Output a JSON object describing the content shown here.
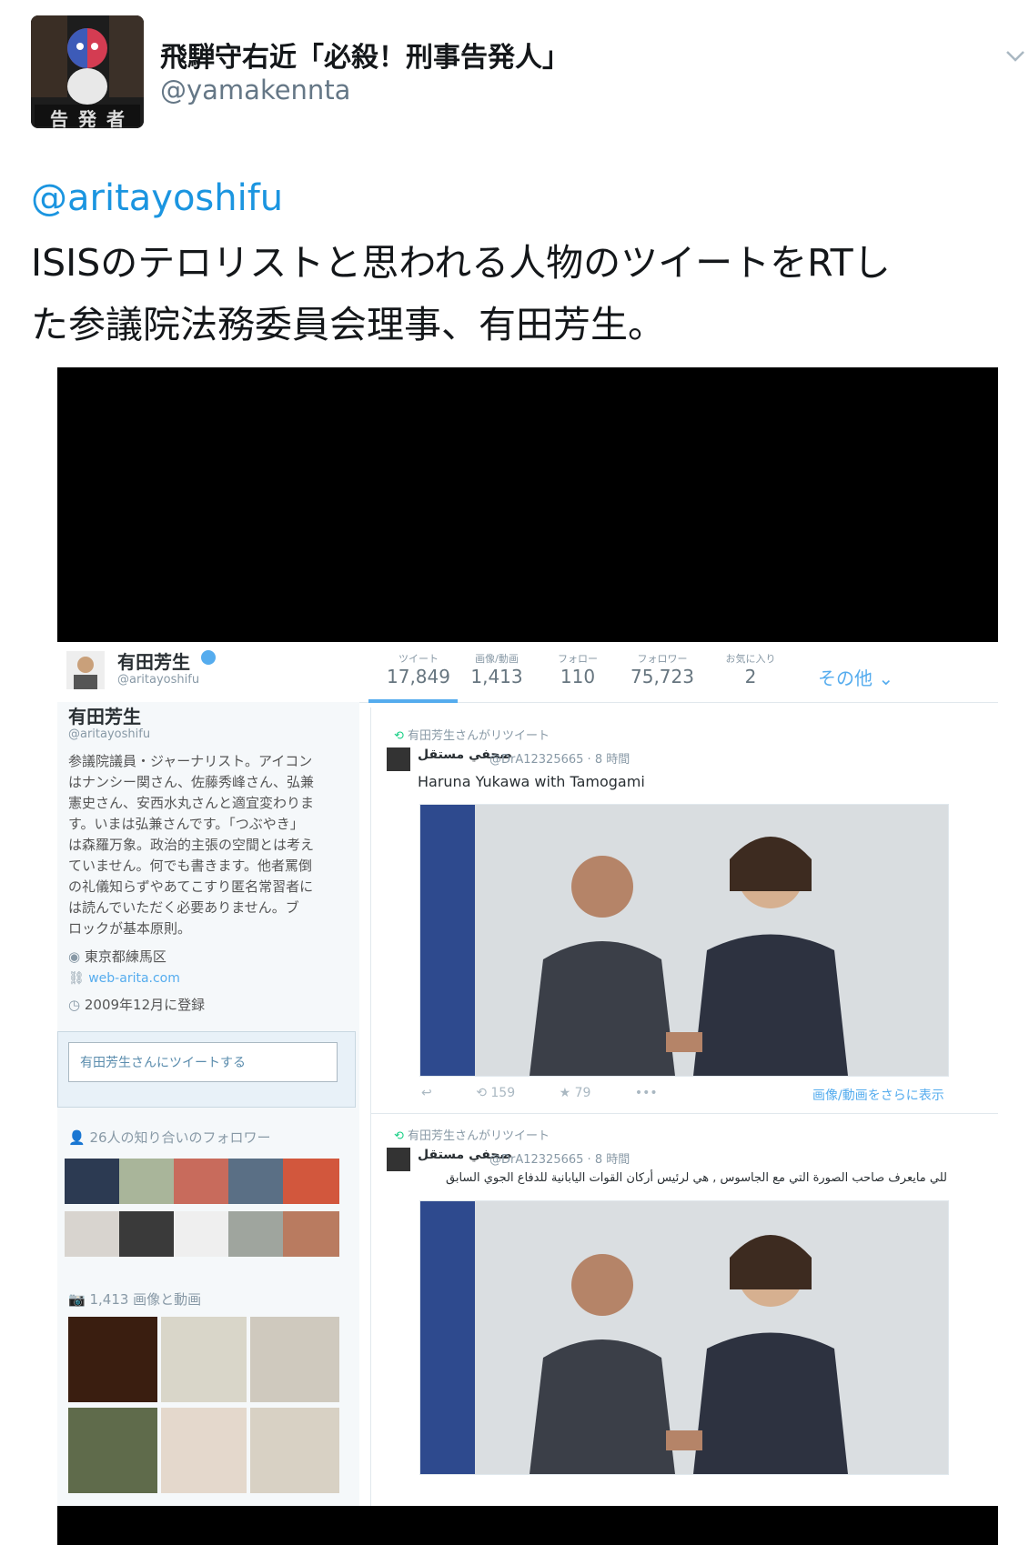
{
  "header": {
    "display_name": "飛騨守右近「必殺！刑事告発人」",
    "handle": "@yamakennta",
    "avatar_text": "告 発 者"
  },
  "tweet": {
    "mention": "@aritayoshifu",
    "line1": "ISISのテロリストと思われる人物のツイートをRTし",
    "line2": "た参議院法務委員会理事、有田芳生。"
  },
  "screenshot": {
    "profile_name": "有田芳生",
    "profile_handle": "@aritayoshifu",
    "stats": [
      {
        "label": "ツイート",
        "value": "17,849"
      },
      {
        "label": "画像/動画",
        "value": "1,413"
      },
      {
        "label": "フォロー",
        "value": "110"
      },
      {
        "label": "フォロワー",
        "value": "75,723"
      },
      {
        "label": "お気に入り",
        "value": "2"
      }
    ],
    "more_label": "その他",
    "bio_name": "有田芳生",
    "bio_handle": "@aritayoshifu",
    "bio_lines": [
      "参議院議員・ジャーナリスト。アイコン",
      "はナンシー関さん、佐藤秀峰さん、弘兼",
      "憲史さん、安西水丸さんと適宜変わりま",
      "す。いまは弘兼さんです。「つぶやき」",
      "は森羅万象。政治的主張の空間とは考え",
      "ていません。何でも書きます。他者罵倒",
      "の礼儀知らずやあてこすり匿名常習者に",
      "は読んでいただく必要ありません。ブ",
      "ロックが基本原則。"
    ],
    "location": "東京都練馬区",
    "website": "web-arita.com",
    "joined": "2009年12月に登録",
    "tweet_to_button": "有田芳生さんにツイートする",
    "followers_you_know": "26人の知り合いのフォロワー",
    "media_count": "1,413 画像と動画",
    "retweet_label": "有田芳生さんがリツイート",
    "rt_author": "صحفي مستقل",
    "rt_handle": "@DrA12325665 · 8 時間",
    "rt1_text": "Haruna Yukawa with Tamogami",
    "rt1_reply_count": "159",
    "rt1_fav_count": "79",
    "rt1_more_media": "画像/動画をさらに表示",
    "rt2_text": "للي مايعرف صاحب الصورة التي مع الجاسوس , هي لرئيس أركان القوات اليابانية للدفاع الجوي السابق"
  },
  "colors": {
    "accent": "#1b95e0",
    "text": "#14171a",
    "muted": "#657786",
    "black_frame": "#000000"
  }
}
